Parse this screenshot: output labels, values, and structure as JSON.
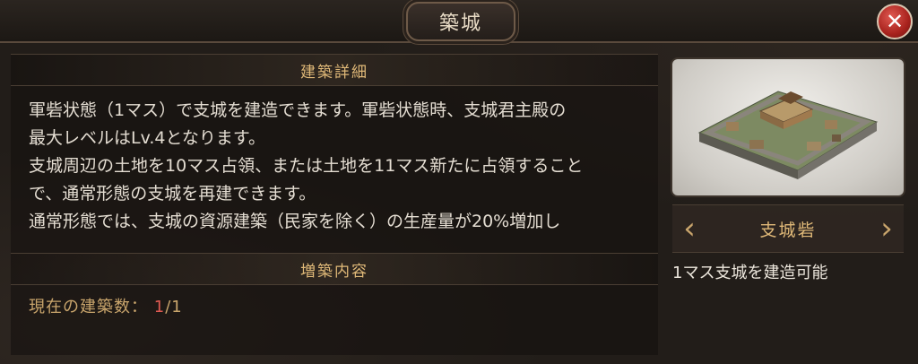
{
  "window": {
    "title": "築城",
    "close_label": "✕"
  },
  "details": {
    "header": "建築詳細",
    "lines": [
      "軍砦状態（1マス）で支城を建造できます。軍砦状態時、支城君主殿の",
      "最大レベルはLv.4となります。",
      "支城周辺の土地を10マス占領、または土地を11マス新たに占領すること",
      "で、通常形態の支城を再建できます。",
      "通常形態では、支城の資源建築（民家を除く）の生産量が20%増加し"
    ]
  },
  "expansion": {
    "header": "増築内容",
    "count_label": "現在の建築数：",
    "count_current": "1",
    "count_total": "/1"
  },
  "castle": {
    "name": "支城砦",
    "description": "1マス支城を建造可能",
    "prev_icon": "chevron-left",
    "next_icon": "chevron-right"
  },
  "colors": {
    "accent_gold": "#e0b978",
    "text_light": "#e4ddd2",
    "highlight_red": "#e05a52"
  }
}
